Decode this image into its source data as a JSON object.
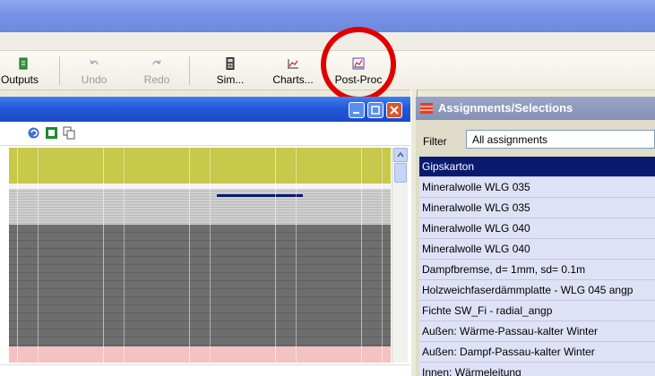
{
  "toolbar": {
    "items": [
      {
        "label": "Outputs",
        "icon": "outputs-icon"
      },
      {
        "label": "Undo",
        "icon": "undo-icon",
        "disabled": true
      },
      {
        "label": "Redo",
        "icon": "redo-icon",
        "disabled": true
      },
      {
        "label": "Sim...",
        "icon": "simulation-calculator-icon"
      },
      {
        "label": "Charts...",
        "icon": "charts-icon"
      },
      {
        "label": "Post-Proc",
        "icon": "post-processing-icon"
      }
    ]
  },
  "left_window": {
    "tool_icons": [
      "refresh-icon",
      "square-icon",
      "copy-icon"
    ],
    "colors": {
      "yellow": "#c8c84a",
      "light_gray": "#c9c9c9",
      "dark_gray": "#6e6e6e",
      "pink": "#f3c2c2",
      "marker": "#0a1a6e"
    }
  },
  "right_window": {
    "title": "Assignments/Selections",
    "filter_label": "Filter",
    "filter_value": "All assignments",
    "items": [
      "Gipskarton",
      "Mineralwolle WLG 035",
      "Mineralwolle WLG 035",
      "Mineralwolle WLG 040",
      "Mineralwolle WLG 040",
      "Dampfbremse, d= 1mm, sd= 0.1m",
      "Holzweichfaserdämmplatte - WLG 045 angp",
      "Fichte SW_Fi - radial_angp",
      "Außen: Wärme-Passau-kalter Winter",
      "Außen: Dampf-Passau-kalter Winter",
      "Innen: Wärmeleitung"
    ],
    "selected_index": 0
  },
  "annotation": {
    "color": "#e00000",
    "target": "Post-Proc"
  }
}
